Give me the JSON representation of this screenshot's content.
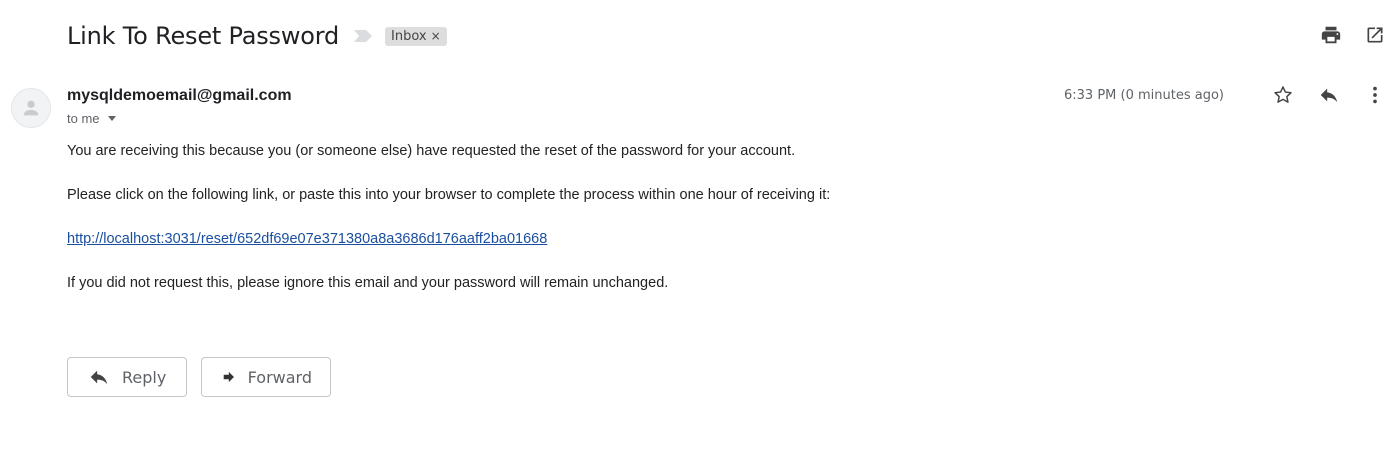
{
  "subject": "Link To Reset Password",
  "label": "Inbox",
  "label_remove": "×",
  "sender": "mysqldemoemail@gmail.com",
  "recipient_line": "to me",
  "timestamp": "6:33 PM (0 minutes ago)",
  "body": {
    "p1": "You are receiving this because you (or someone else) have requested the reset of the password for your account.",
    "p2": "Please click on the following link, or paste this into your browser to complete the process within one hour of receiving it:",
    "link": "http://localhost:3031/reset/652df69e07e371380a8a3686d176aaff2ba01668",
    "p3": "If you did not request this, please ignore this email and your password will remain unchanged."
  },
  "buttons": {
    "reply": "Reply",
    "forward": "Forward"
  },
  "icons": {
    "importance": "importance-marker-icon",
    "print": "print-icon",
    "open_new_window": "open-in-new-window-icon",
    "star": "star-icon",
    "reply": "reply-icon",
    "more": "more-vert-icon",
    "avatar": "person-icon"
  },
  "colors": {
    "link": "#1a4fa0",
    "secondary_text": "#5f6368",
    "chip_bg": "#dddddd"
  }
}
